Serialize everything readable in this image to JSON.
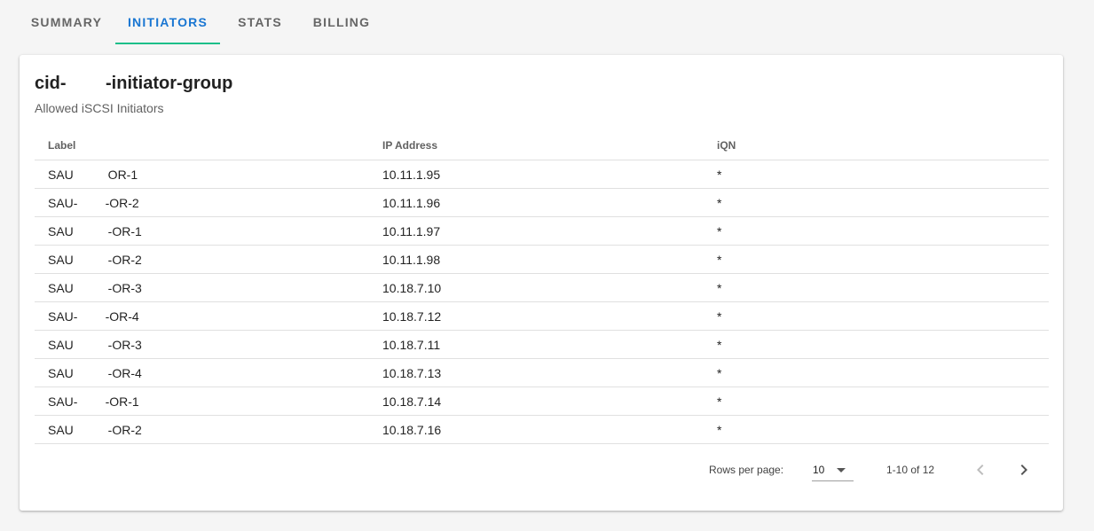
{
  "tabs": [
    {
      "label": "SUMMARY"
    },
    {
      "label": "INITIATORS"
    },
    {
      "label": "STATS"
    },
    {
      "label": "BILLING"
    }
  ],
  "active_tab": "INITIATORS",
  "colors": {
    "active_tab_text": "#1976d2",
    "active_tab_indicator": "#1dbf8a"
  },
  "card": {
    "title": "cid-        -initiator-group",
    "subtitle": "Allowed iSCSI Initiators"
  },
  "table": {
    "columns": [
      "Label",
      "IP Address",
      "iQN"
    ],
    "rows": [
      {
        "label": "SAU          OR-1",
        "ip": "10.11.1.95",
        "iqn": "*"
      },
      {
        "label": "SAU-        -OR-2",
        "ip": "10.11.1.96",
        "iqn": "*"
      },
      {
        "label": "SAU          -OR-1",
        "ip": "10.11.1.97",
        "iqn": "*"
      },
      {
        "label": "SAU          -OR-2",
        "ip": "10.11.1.98",
        "iqn": "*"
      },
      {
        "label": "SAU          -OR-3",
        "ip": "10.18.7.10",
        "iqn": "*"
      },
      {
        "label": "SAU-        -OR-4",
        "ip": "10.18.7.12",
        "iqn": "*"
      },
      {
        "label": "SAU          -OR-3",
        "ip": "10.18.7.11",
        "iqn": "*"
      },
      {
        "label": "SAU          -OR-4",
        "ip": "10.18.7.13",
        "iqn": "*"
      },
      {
        "label": "SAU-        -OR-1",
        "ip": "10.18.7.14",
        "iqn": "*"
      },
      {
        "label": "SAU          -OR-2",
        "ip": "10.18.7.16",
        "iqn": "*"
      }
    ]
  },
  "pagination": {
    "rows_per_page_label": "Rows per page:",
    "rows_per_page_value": "10",
    "range_text": "1-10 of 12",
    "prev_icon": "chevron-left-icon",
    "next_icon": "chevron-right-icon"
  }
}
